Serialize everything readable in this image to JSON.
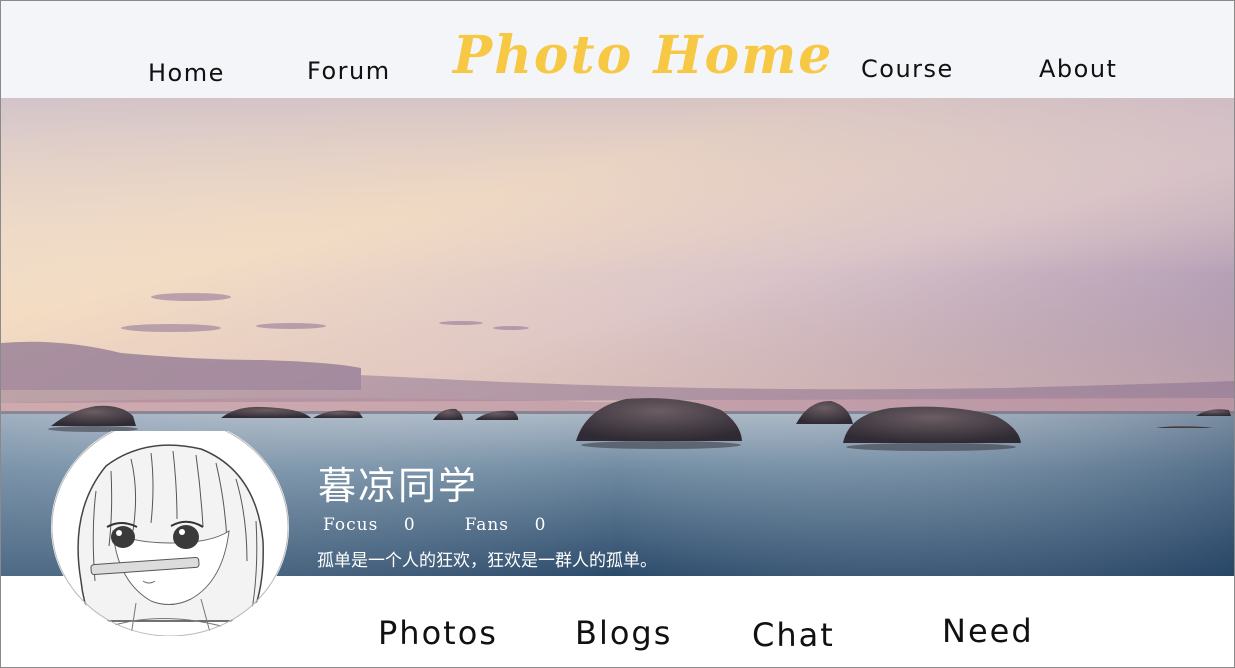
{
  "nav": {
    "home": "Home",
    "forum": "Forum",
    "brand": "Photo Home",
    "course": "Course",
    "about": "About"
  },
  "profile": {
    "name": "暮凉同学",
    "focus_label": "Focus",
    "focus_count": "0",
    "fans_label": "Fans",
    "fans_count": "0",
    "motto": "孤单是一个人的狂欢，狂欢是一群人的孤单。"
  },
  "tabs": {
    "photos": "Photos",
    "blogs": "Blogs",
    "chat": "Chat",
    "need": "Need"
  },
  "colors": {
    "brand": "#f7c843",
    "header_bg": "#f4f5f9"
  }
}
